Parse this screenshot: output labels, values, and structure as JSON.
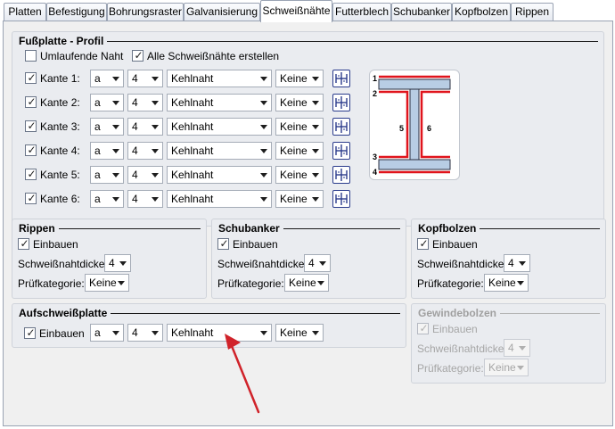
{
  "tabs": [
    {
      "label": "Platten"
    },
    {
      "label": "Befestigung"
    },
    {
      "label": "Bohrungsraster"
    },
    {
      "label": "Galvanisierung"
    },
    {
      "label": "Schweißnähte"
    },
    {
      "label": "Futterblech"
    },
    {
      "label": "Schubanker"
    },
    {
      "label": "Kopfbolzen"
    },
    {
      "label": "Rippen"
    }
  ],
  "active_tab": "Schweißnähte",
  "fussplatte": {
    "title": "Fußplatte - Profil",
    "umlaufende_naht": {
      "label": "Umlaufende Naht",
      "checked": false
    },
    "alle_schweissnaehte": {
      "label": "Alle Schweißnähte erstellen",
      "checked": true
    },
    "rows": [
      {
        "label": "Kante 1:",
        "checked": true,
        "type": "a",
        "size": "4",
        "weld": "Kehlnaht",
        "test": "Keine"
      },
      {
        "label": "Kante 2:",
        "checked": true,
        "type": "a",
        "size": "4",
        "weld": "Kehlnaht",
        "test": "Keine"
      },
      {
        "label": "Kante 3:",
        "checked": true,
        "type": "a",
        "size": "4",
        "weld": "Kehlnaht",
        "test": "Keine"
      },
      {
        "label": "Kante 4:",
        "checked": true,
        "type": "a",
        "size": "4",
        "weld": "Kehlnaht",
        "test": "Keine"
      },
      {
        "label": "Kante 5:",
        "checked": true,
        "type": "a",
        "size": "4",
        "weld": "Kehlnaht",
        "test": "Keine"
      },
      {
        "label": "Kante 6:",
        "checked": true,
        "type": "a",
        "size": "4",
        "weld": "Kehlnaht",
        "test": "Keine"
      }
    ],
    "profile_labels": [
      "1",
      "2",
      "3",
      "4",
      "5",
      "6"
    ]
  },
  "rippen": {
    "title": "Rippen",
    "einbauen": {
      "label": "Einbauen",
      "checked": true
    },
    "dicke_label": "Schweißnahtdicke:",
    "dicke_value": "4",
    "pruef_label": "Prüfkategorie:",
    "pruef_value": "Keine"
  },
  "schubanker": {
    "title": "Schubanker",
    "einbauen": {
      "label": "Einbauen",
      "checked": true
    },
    "dicke_label": "Schweißnahtdicke:",
    "dicke_value": "4",
    "pruef_label": "Prüfkategorie:",
    "pruef_value": "Keine"
  },
  "kopfbolzen": {
    "title": "Kopfbolzen",
    "einbauen": {
      "label": "Einbauen",
      "checked": true
    },
    "dicke_label": "Schweißnahtdicke:",
    "dicke_value": "4",
    "pruef_label": "Prüfkategorie:",
    "pruef_value": "Keine"
  },
  "aufschweissplatte": {
    "title": "Aufschweißplatte",
    "einbauen": {
      "label": "Einbauen",
      "checked": true
    },
    "type": "a",
    "size": "4",
    "weld": "Kehlnaht",
    "test": "Keine"
  },
  "gewindebolzen": {
    "title": "Gewindebolzen",
    "einbauen": {
      "label": "Einbauen",
      "checked": true
    },
    "dicke_label": "Schweißnahtdicke:",
    "dicke_value": "4",
    "pruef_label": "Prüfkategorie:",
    "pruef_value": "Keine",
    "disabled": true
  },
  "colors": {
    "weld_red": "#e0141c",
    "flange_blue": "#b8cde4",
    "annotation_arrow": "#d0232a",
    "button_border": "#2b3c8c"
  },
  "icons": [
    "weld-symbol-icon",
    "checkmark-icon",
    "chevron-down-icon",
    "arrow-annotation-icon"
  ]
}
